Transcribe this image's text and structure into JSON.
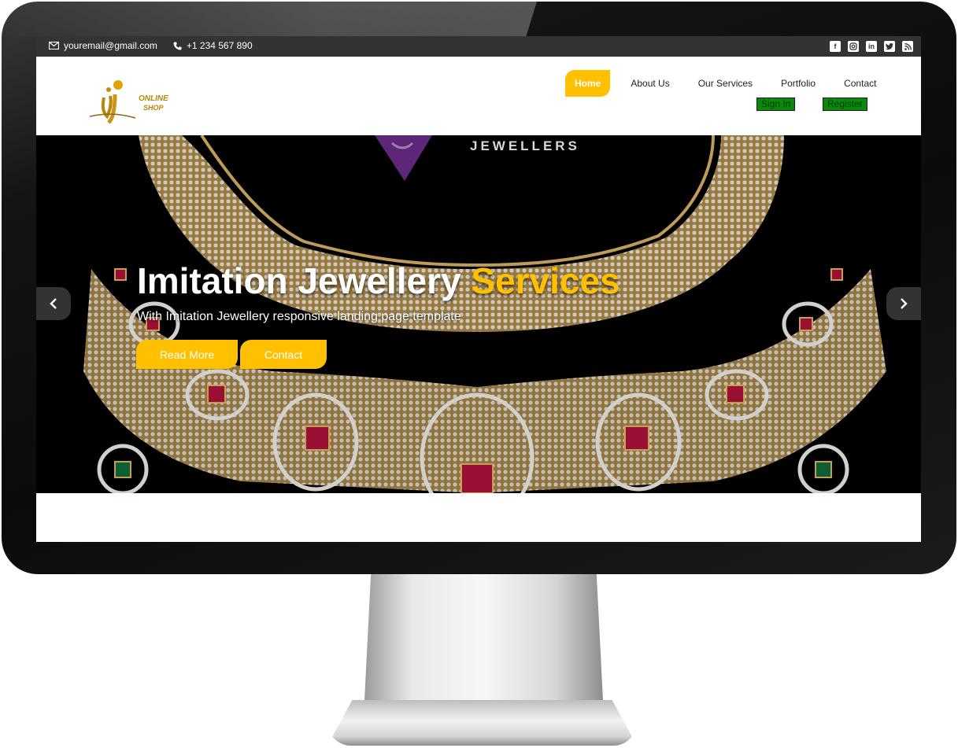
{
  "topbar": {
    "email": "youremail@gmail.com",
    "phone": "+1 234 567 890",
    "email_icon": "envelope-icon",
    "phone_icon": "phone-icon",
    "social_icons": [
      "facebook-icon",
      "instagram-icon",
      "linkedin-icon",
      "twitter-icon",
      "rss-icon"
    ]
  },
  "header": {
    "logo_line1": "ONLINE",
    "logo_line2": "SHOP",
    "nav": [
      {
        "label": "Home",
        "active": true
      },
      {
        "label": "About Us"
      },
      {
        "label": "Our Services"
      },
      {
        "label": "Portfolio"
      },
      {
        "label": "Contact"
      }
    ],
    "sign_in": "Sign In",
    "register": "Register"
  },
  "hero": {
    "brand_word": "JEWELLERS",
    "title_main": "Imitation Jewellery",
    "title_accent": "Services",
    "subtitle": "With Imitation Jewellery responsive landing page template",
    "read_more": "Read More",
    "contact": "Contact",
    "prev_icon": "chevron-left-icon",
    "next_icon": "chevron-right-icon"
  },
  "colors": {
    "accent": "#ffc000",
    "topbar": "#333333",
    "auth_button": "#0a8a0a"
  }
}
